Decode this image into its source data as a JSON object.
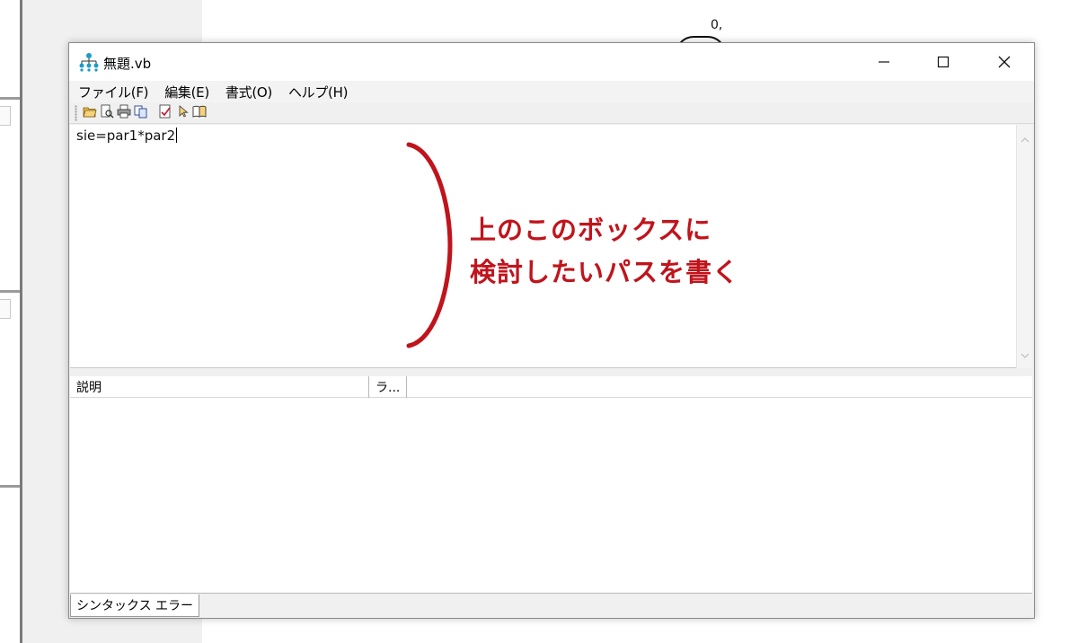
{
  "background": {
    "canvas_label": "0,"
  },
  "window": {
    "title": "無題.vb",
    "app_icon": "network-tree-icon",
    "controls": {
      "minimize_icon": "minimize-icon",
      "maximize_icon": "maximize-icon",
      "close_icon": "close-icon"
    }
  },
  "menu": {
    "items": [
      {
        "label": "ファイル(F)"
      },
      {
        "label": "編集(E)"
      },
      {
        "label": "書式(O)"
      },
      {
        "label": "ヘルプ(H)"
      }
    ]
  },
  "toolbar": {
    "buttons": [
      {
        "icon": "open-folder-icon"
      },
      {
        "icon": "print-preview-icon"
      },
      {
        "icon": "print-icon"
      },
      {
        "icon": "copy-icon"
      },
      {
        "icon": "check-syntax-icon"
      },
      {
        "icon": "help-pointer-icon"
      },
      {
        "icon": "book-icon"
      }
    ]
  },
  "editor": {
    "content": "sie=par1*par2"
  },
  "annotation": {
    "text": "上のこのボックスに\n検討したいパスを書く",
    "color": "#c0141c"
  },
  "list": {
    "columns": [
      {
        "label": "説明"
      },
      {
        "label": "ラ..."
      }
    ]
  },
  "tabs": {
    "active": "シンタックス エラー"
  }
}
